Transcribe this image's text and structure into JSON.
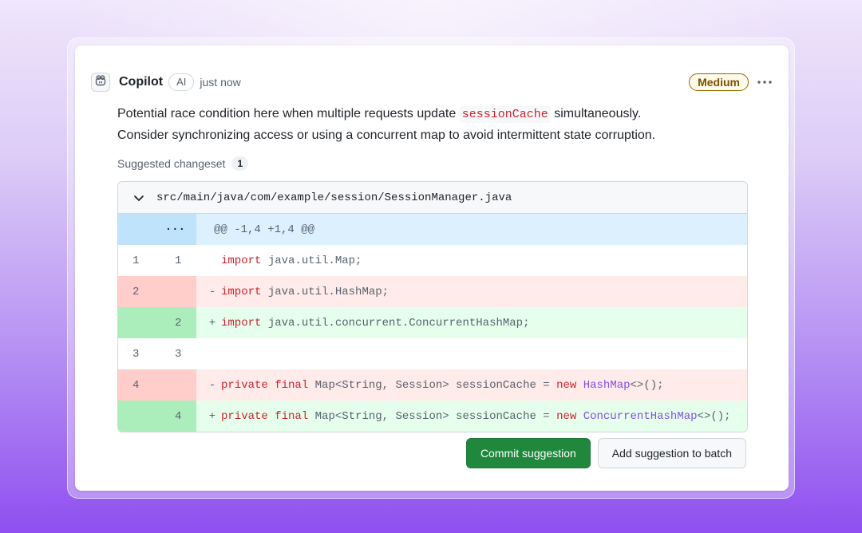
{
  "comment": {
    "author": "Copilot",
    "author_badge": "AI",
    "timestamp": "just now",
    "severity": "Medium",
    "message_part1": "Potential race condition here when multiple requests update ",
    "message_code": "sessionCache",
    "message_part2": " simultaneously.",
    "message_line2": "Consider synchronizing access or using a concurrent map to avoid intermittent state corruption.",
    "changeset_label": "Suggested changeset",
    "changeset_count": "1"
  },
  "diff": {
    "file_path": "src/main/java/com/example/session/SessionManager.java",
    "hunk_header": "@@ -1,4 +1,4 @@",
    "lines": [
      {
        "type": "context",
        "old": "1",
        "new": "1",
        "sign": "",
        "kw": "import",
        "rest": " java.util.Map;"
      },
      {
        "type": "del",
        "old": "2",
        "new": "",
        "sign": "-",
        "kw": "import",
        "rest": " java.util.HashMap;"
      },
      {
        "type": "add",
        "old": "",
        "new": "2",
        "sign": "+",
        "kw": "import",
        "rest": " java.util.concurrent.ConcurrentHashMap;"
      },
      {
        "type": "context",
        "old": "3",
        "new": "3",
        "sign": "",
        "kw": "",
        "rest": ""
      },
      {
        "type": "del",
        "old": "4",
        "new": "",
        "sign": "-",
        "kw1": "private",
        "kw2": "final",
        "mid": " Map<String, Session> sessionCache = ",
        "kw3": "new",
        "ty": "HashMap",
        "tail": "<>();"
      },
      {
        "type": "add",
        "old": "",
        "new": "4",
        "sign": "+",
        "kw1": "private",
        "kw2": "final",
        "mid": " Map<String, Session> sessionCache = ",
        "kw3": "new",
        "ty": "ConcurrentHashMap",
        "tail": "<>();"
      }
    ]
  },
  "actions": {
    "commit_label": "Commit suggestion",
    "batch_label": "Add suggestion to batch"
  },
  "colors": {
    "primary_button": "#1f883d",
    "severity_medium": "#9a6700",
    "deletion_bg": "#ffebe9",
    "addition_bg": "#e6ffec",
    "hunk_bg": "#dcf0fd"
  }
}
